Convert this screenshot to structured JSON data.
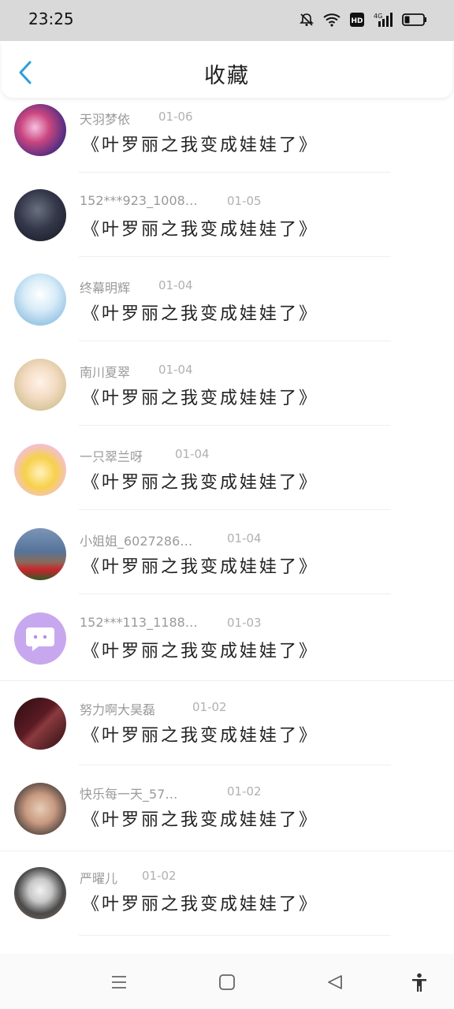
{
  "status": {
    "time": "23:25",
    "icons": [
      "bell-muted-icon",
      "wifi-icon",
      "hd-icon",
      "signal-4g-icon",
      "battery-icon"
    ],
    "hd": "HD",
    "net": "4G"
  },
  "header": {
    "title": "收藏"
  },
  "items": [
    {
      "name": "天羽梦依",
      "date": "01-06",
      "message": "《叶罗丽之我变成娃娃了》"
    },
    {
      "name": "152***923_1008…",
      "date": "01-05",
      "message": "《叶罗丽之我变成娃娃了》"
    },
    {
      "name": "终幕明辉",
      "date": "01-04",
      "message": "《叶罗丽之我变成娃娃了》"
    },
    {
      "name": "南川夏翠",
      "date": "01-04",
      "message": "《叶罗丽之我变成娃娃了》"
    },
    {
      "name": "一只翠兰呀",
      "date": "01-04",
      "message": "《叶罗丽之我变成娃娃了》"
    },
    {
      "name": "小姐姐_6027286…",
      "date": "01-04",
      "message": "《叶罗丽之我变成娃娃了》"
    },
    {
      "name": "152***113_1188…",
      "date": "01-03",
      "message": "《叶罗丽之我变成娃娃了》"
    },
    {
      "name": "努力啊大昊磊",
      "date": "01-02",
      "message": "《叶罗丽之我变成娃娃了》"
    },
    {
      "name": "快乐每一天_57…",
      "date": "01-02",
      "message": "《叶罗丽之我变成娃娃了》"
    },
    {
      "name": "严曜儿",
      "date": "01-02",
      "message": "《叶罗丽之我变成娃娃了》"
    }
  ],
  "nav": [
    "menu-icon",
    "home-square-icon",
    "back-triangle-icon",
    "accessibility-icon"
  ]
}
